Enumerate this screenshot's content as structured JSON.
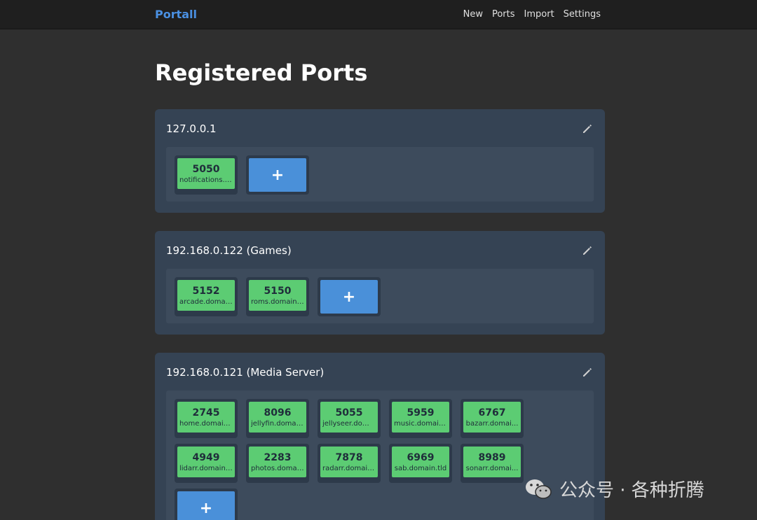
{
  "navbar": {
    "brand": "Portall",
    "links": [
      "New",
      "Ports",
      "Import",
      "Settings"
    ]
  },
  "page": {
    "title": "Registered Ports"
  },
  "hosts": [
    {
      "name": "127.0.0.1",
      "ports": [
        {
          "number": "5050",
          "domain": "notifications.d..."
        }
      ]
    },
    {
      "name": "192.168.0.122 (Games)",
      "ports": [
        {
          "number": "5152",
          "domain": "arcade.domai..."
        },
        {
          "number": "5150",
          "domain": "roms.domain...."
        }
      ]
    },
    {
      "name": "192.168.0.121 (Media Server)",
      "ports": [
        {
          "number": "2745",
          "domain": "home.domain...."
        },
        {
          "number": "8096",
          "domain": "jellyfin.domai..."
        },
        {
          "number": "5055",
          "domain": "jellyseer.dom..."
        },
        {
          "number": "5959",
          "domain": "music.domain...."
        },
        {
          "number": "6767",
          "domain": "bazarr.domai..."
        },
        {
          "number": "4949",
          "domain": "lidarr.domain...."
        },
        {
          "number": "2283",
          "domain": "photos.domai..."
        },
        {
          "number": "7878",
          "domain": "radarr.domain...."
        },
        {
          "number": "6969",
          "domain": "sab.domain.tld"
        },
        {
          "number": "8989",
          "domain": "sonarr.domai..."
        }
      ]
    }
  ],
  "add_label": "+",
  "watermark": {
    "text": "公众号 · 各种折腾",
    "icon": "wechat-icon"
  },
  "colors": {
    "brand": "#4a90e2",
    "port_green": "#5ccc73",
    "add_blue": "#4a90d9",
    "card_bg": "#354354"
  },
  "icons": {
    "edit": "pencil-icon"
  }
}
